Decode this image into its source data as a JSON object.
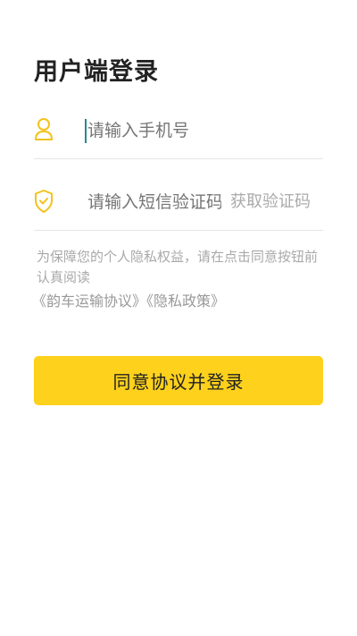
{
  "page": {
    "title": "用户端登录"
  },
  "form": {
    "phone_placeholder": "请输入手机号",
    "code_placeholder": "请输入短信验证码",
    "get_code_label": "获取验证码"
  },
  "agreement": {
    "notice": "为保障您的个人隐私权益，请在点击同意按钮前认真阅读",
    "link_transport": "《韵车运输协议》",
    "link_privacy": "《隐私政策》"
  },
  "submit": {
    "label": "同意协议并登录"
  },
  "colors": {
    "accent": "#fdd11c",
    "icon": "#f3c21a",
    "caret": "#2a8a8a"
  },
  "icons": {
    "phone": "user-icon",
    "code": "shield-check-icon"
  }
}
